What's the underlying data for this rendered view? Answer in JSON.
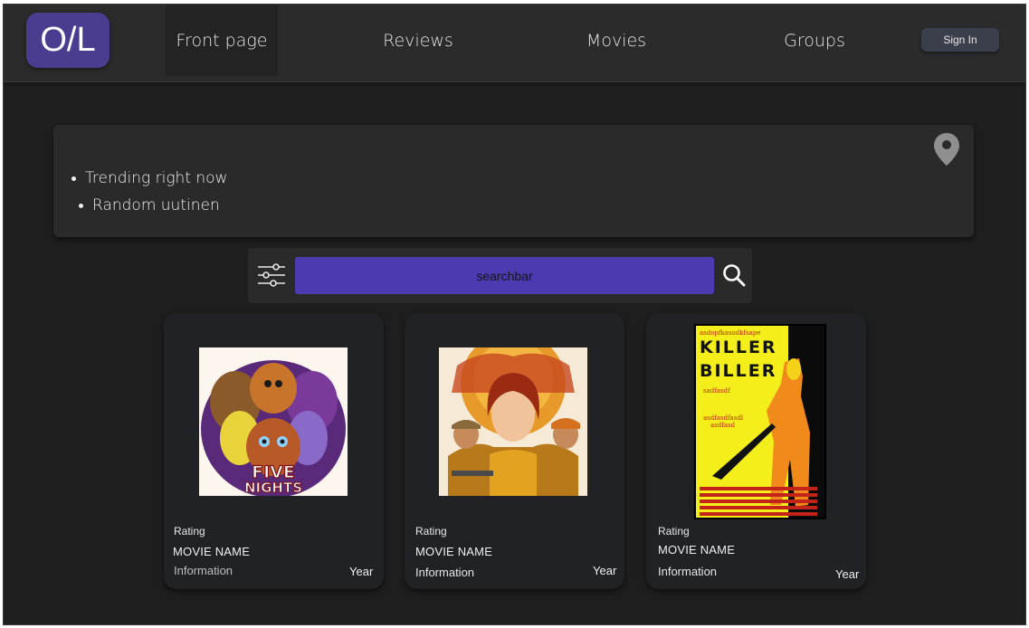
{
  "header": {
    "logo": "O/L",
    "nav": [
      "Front page",
      "Reviews",
      "Movies",
      "Groups"
    ],
    "active_nav": "Front page",
    "signin_label": "Sign In"
  },
  "trending": {
    "items": [
      "Trending right now",
      "Random uutinen"
    ],
    "location_icon": "map-pin-icon"
  },
  "search": {
    "placeholder": "searchbar",
    "filter_icon": "sliders-icon",
    "search_icon": "magnifier-icon"
  },
  "cards": [
    {
      "rating": "Rating",
      "name": "MOVIE NAME",
      "info": "Information",
      "year": "Year",
      "poster_text": [
        "FIVE",
        "NIGHTS"
      ]
    },
    {
      "rating": "Rating",
      "name": "MOVIE NAME",
      "info": "Information",
      "year": "Year"
    },
    {
      "rating": "Rating",
      "name": "MOVIE NAME",
      "info": "Information",
      "year": "Year",
      "poster_text": [
        "asdopfkasodkfsape",
        "KILLER",
        "BILLER",
        "sadfasdf",
        "asdfasdfasdl",
        "asdfasd"
      ]
    }
  ],
  "colors": {
    "background": "#1e1e1e",
    "header": "#2b2b2b",
    "accent": "#4a3bb0",
    "logo": "#4a3d8f",
    "card": "#202226"
  }
}
